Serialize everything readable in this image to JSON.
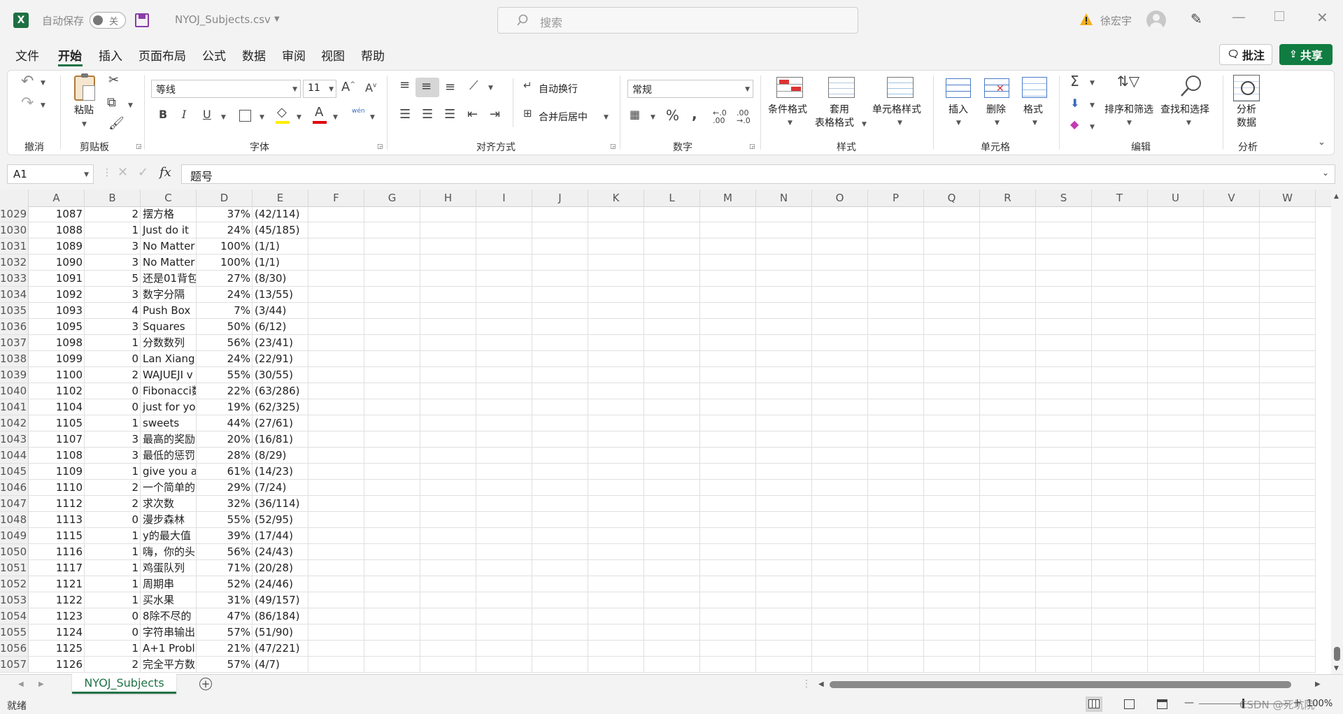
{
  "app": {
    "autosave_label": "自动保存",
    "autosave_state": "关",
    "filename": "NYOJ_Subjects.csv",
    "search_placeholder": "搜索",
    "username": "徐宏宇"
  },
  "menu": {
    "items": [
      "文件",
      "开始",
      "插入",
      "页面布局",
      "公式",
      "数据",
      "审阅",
      "视图",
      "帮助"
    ],
    "active": "开始",
    "comment_button": "批注",
    "share_button": "共享"
  },
  "ribbon": {
    "groups": {
      "undo": "撤消",
      "clipboard": "剪贴板",
      "font": "字体",
      "alignment": "对齐方式",
      "number": "数字",
      "styles": "样式",
      "cells": "单元格",
      "editing": "编辑",
      "analysis": "分析"
    },
    "paste": "粘贴",
    "font_name": "等线",
    "font_size": "11",
    "phonetic": "wén",
    "wrap_text": "自动换行",
    "merge_center": "合并后居中",
    "number_format": "常规",
    "conditional_format": "条件格式",
    "table_format_1": "套用",
    "table_format_2": "表格格式",
    "cell_styles": "单元格样式",
    "insert": "插入",
    "delete": "删除",
    "format": "格式",
    "sort_filter": "排序和筛选",
    "find_select": "查找和选择",
    "analyze_1": "分析",
    "analyze_2": "数据"
  },
  "formula_bar": {
    "name_box": "A1",
    "fx": "fx",
    "content": "题号"
  },
  "columns": [
    "A",
    "B",
    "C",
    "D",
    "E",
    "F",
    "G",
    "H",
    "I",
    "J",
    "K",
    "L",
    "M",
    "N",
    "O",
    "P",
    "Q",
    "R",
    "S",
    "T",
    "U",
    "V",
    "W"
  ],
  "rows": [
    {
      "n": "1029",
      "a": "1087",
      "b": "2",
      "c": "摆方格",
      "d": "37%",
      "e": "(42/114)"
    },
    {
      "n": "1030",
      "a": "1088",
      "b": "1",
      "c": "Just do it",
      "d": "24%",
      "e": "(45/185)"
    },
    {
      "n": "1031",
      "a": "1089",
      "b": "3",
      "c": "No Matter",
      "d": "100%",
      "e": "(1/1)"
    },
    {
      "n": "1032",
      "a": "1090",
      "b": "3",
      "c": "No Matter",
      "d": "100%",
      "e": "(1/1)"
    },
    {
      "n": "1033",
      "a": "1091",
      "b": "5",
      "c": "还是01背包",
      "d": "27%",
      "e": "(8/30)"
    },
    {
      "n": "1034",
      "a": "1092",
      "b": "3",
      "c": "数字分隔",
      "d": "24%",
      "e": "(13/55)"
    },
    {
      "n": "1035",
      "a": "1093",
      "b": "4",
      "c": "Push Box",
      "d": "7%",
      "e": "(3/44)"
    },
    {
      "n": "1036",
      "a": "1095",
      "b": "3",
      "c": "Squares",
      "d": "50%",
      "e": "(6/12)"
    },
    {
      "n": "1037",
      "a": "1098",
      "b": "1",
      "c": "分数数列",
      "d": "56%",
      "e": "(23/41)"
    },
    {
      "n": "1038",
      "a": "1099",
      "b": "0",
      "c": "Lan Xiang",
      "d": "24%",
      "e": "(22/91)"
    },
    {
      "n": "1039",
      "a": "1100",
      "b": "2",
      "c": "WAJUEJI v",
      "d": "55%",
      "e": "(30/55)"
    },
    {
      "n": "1040",
      "a": "1102",
      "b": "0",
      "c": "Fibonacci数",
      "d": "22%",
      "e": "(63/286)"
    },
    {
      "n": "1041",
      "a": "1104",
      "b": "0",
      "c": "just for yo",
      "d": "19%",
      "e": "(62/325)"
    },
    {
      "n": "1042",
      "a": "1105",
      "b": "1",
      "c": "sweets",
      "d": "44%",
      "e": "(27/61)"
    },
    {
      "n": "1043",
      "a": "1107",
      "b": "3",
      "c": "最高的奖励",
      "d": "20%",
      "e": "(16/81)"
    },
    {
      "n": "1044",
      "a": "1108",
      "b": "3",
      "c": "最低的惩罚",
      "d": "28%",
      "e": "(8/29)"
    },
    {
      "n": "1045",
      "a": "1109",
      "b": "1",
      "c": "give you a",
      "d": "61%",
      "e": "(14/23)"
    },
    {
      "n": "1046",
      "a": "1110",
      "b": "2",
      "c": "一个简单的",
      "d": "29%",
      "e": "(7/24)"
    },
    {
      "n": "1047",
      "a": "1112",
      "b": "2",
      "c": "求次数",
      "d": "32%",
      "e": "(36/114)"
    },
    {
      "n": "1048",
      "a": "1113",
      "b": "0",
      "c": "漫步森林",
      "d": "55%",
      "e": "(52/95)"
    },
    {
      "n": "1049",
      "a": "1115",
      "b": "1",
      "c": "y的最大值",
      "d": "39%",
      "e": "(17/44)"
    },
    {
      "n": "1050",
      "a": "1116",
      "b": "1",
      "c": "嗨，你的头",
      "d": "56%",
      "e": "(24/43)"
    },
    {
      "n": "1051",
      "a": "1117",
      "b": "1",
      "c": "鸡蛋队列",
      "d": "71%",
      "e": "(20/28)"
    },
    {
      "n": "1052",
      "a": "1121",
      "b": "1",
      "c": "周期串",
      "d": "52%",
      "e": "(24/46)"
    },
    {
      "n": "1053",
      "a": "1122",
      "b": "1",
      "c": "买水果",
      "d": "31%",
      "e": "(49/157)"
    },
    {
      "n": "1054",
      "a": "1123",
      "b": "0",
      "c": "8除不尽的",
      "d": "47%",
      "e": "(86/184)"
    },
    {
      "n": "1055",
      "a": "1124",
      "b": "0",
      "c": "字符串输出",
      "d": "57%",
      "e": "(51/90)"
    },
    {
      "n": "1056",
      "a": "1125",
      "b": "1",
      "c": "A+1 Probl",
      "d": "21%",
      "e": "(47/221)"
    },
    {
      "n": "1057",
      "a": "1126",
      "b": "2",
      "c": "完全平方数",
      "d": "57%",
      "e": "(4/7)"
    }
  ],
  "sheet_tab": "NYOJ_Subjects",
  "status": {
    "ready": "就绪",
    "zoom": "100%",
    "watermark": "CSDN @死坑院"
  },
  "colors": {
    "accent": "#217346",
    "share_bg": "#107c41"
  }
}
